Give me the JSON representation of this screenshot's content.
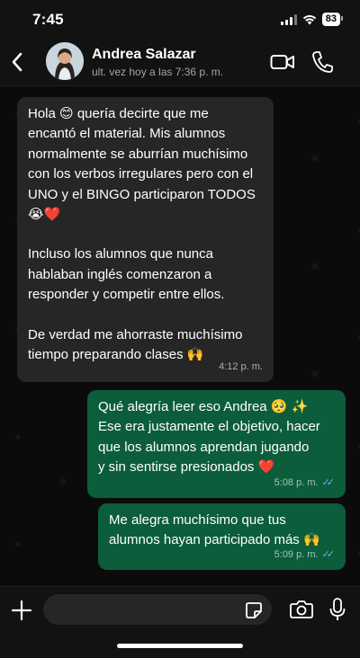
{
  "status_bar": {
    "time": "7:45",
    "battery": "83"
  },
  "header": {
    "contact_name": "Andrea Salazar",
    "last_seen": "ult. vez hoy a las 7:36 p. m."
  },
  "messages": [
    {
      "direction": "incoming",
      "lines": [
        "Hola 😊 quería decirte que me",
        "encantó el material. Mis alumnos",
        "normalmente se aburrían muchísimo",
        "con los verbos irregulares pero con el",
        "UNO y el BINGO participaron TODOS",
        "😭❤️",
        "",
        "Incluso los alumnos que nunca",
        "hablaban inglés comenzaron a",
        "responder y competir entre ellos.",
        "",
        "De verdad me ahorraste muchísimo",
        "tiempo preparando clases 🙌"
      ],
      "time": "4:12 p. m."
    },
    {
      "direction": "outgoing",
      "lines": [
        "Qué alegría leer eso Andrea 🥺 ✨",
        "Ese era justamente el objetivo, hacer",
        "que los alumnos aprendan jugando",
        "y sin sentirse presionados ❤️"
      ],
      "time": "5:08 p. m.",
      "read": true
    },
    {
      "direction": "outgoing",
      "lines": [
        "Me alegra muchísimo que tus",
        "alumnos hayan participado más 🙌"
      ],
      "time": "5:09 p. m.",
      "read": true
    }
  ],
  "input": {
    "placeholder": "",
    "value": ""
  },
  "colors": {
    "incoming_bubble": "#262626",
    "outgoing_bubble": "#0b5d3b",
    "read_ticks": "#53bdeb",
    "background": "#0b0b0b"
  },
  "icons": [
    "chevron-left-icon",
    "video-camera-icon",
    "phone-icon",
    "plus-icon",
    "sticker-icon",
    "camera-icon",
    "microphone-icon",
    "double-check-icon"
  ]
}
